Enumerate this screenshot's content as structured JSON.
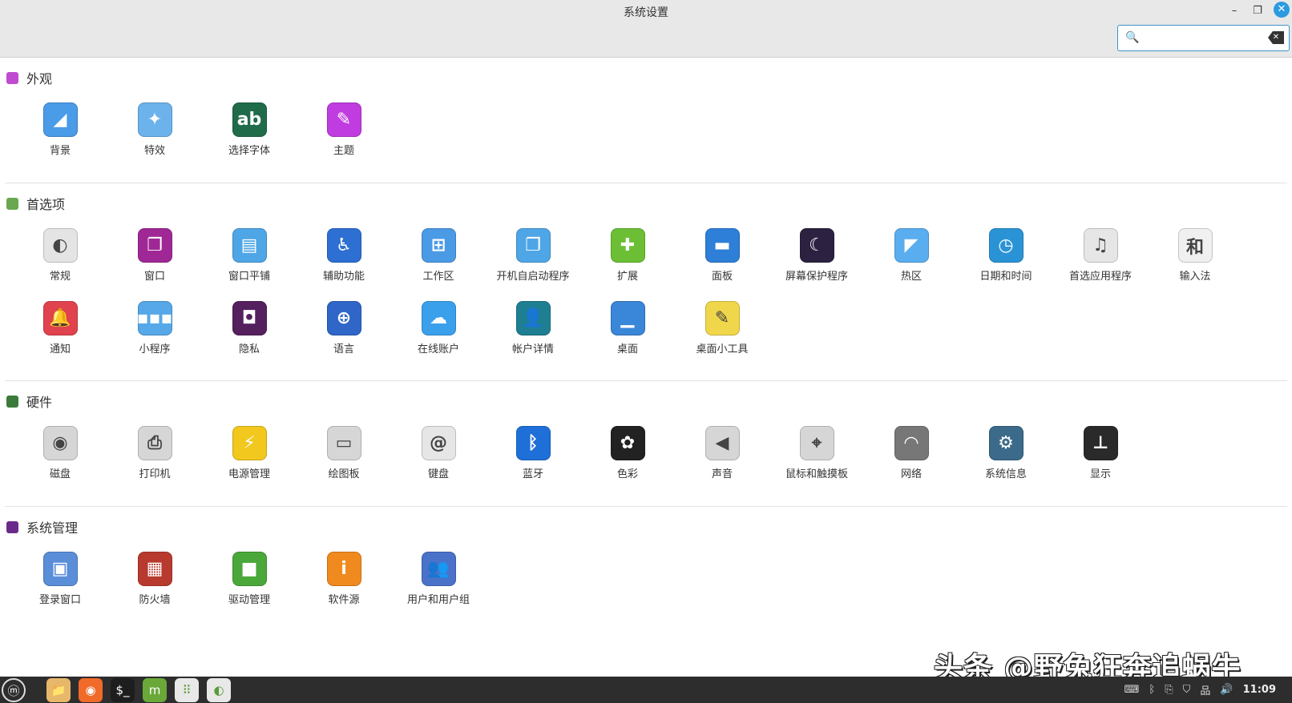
{
  "window": {
    "title": "系统设置",
    "minimize": "–",
    "maximize": "❐",
    "close": "✕"
  },
  "search": {
    "value": "",
    "placeholder": "",
    "icon": "search-icon",
    "clear_icon": "clear-icon"
  },
  "sections": [
    {
      "title": "外观",
      "color": "#c04bd0",
      "items": [
        {
          "label": "背景",
          "color": "#4a9be8",
          "glyph": "◢"
        },
        {
          "label": "特效",
          "color": "#6cb3ec",
          "glyph": "✦"
        },
        {
          "label": "选择字体",
          "color": "#1f6b4a",
          "glyph": "ab"
        },
        {
          "label": "主题",
          "color": "#c03ce0",
          "glyph": "✎"
        }
      ]
    },
    {
      "title": "首选项",
      "color": "#6aa84f",
      "items": [
        {
          "label": "常规",
          "color": "#e4e4e4",
          "glyph": "◐"
        },
        {
          "label": "窗口",
          "color": "#a02896",
          "glyph": "❐"
        },
        {
          "label": "窗口平铺",
          "color": "#4fa6e6",
          "glyph": "▤"
        },
        {
          "label": "辅助功能",
          "color": "#2d6fd2",
          "glyph": "♿"
        },
        {
          "label": "工作区",
          "color": "#4b9ae6",
          "glyph": "⊞"
        },
        {
          "label": "开机自启动程序",
          "color": "#4fa6e6",
          "glyph": "❐"
        },
        {
          "label": "扩展",
          "color": "#6cbf35",
          "glyph": "✚"
        },
        {
          "label": "面板",
          "color": "#2e7fd8",
          "glyph": "▬"
        },
        {
          "label": "屏幕保护程序",
          "color": "#2c2140",
          "glyph": "☾"
        },
        {
          "label": "热区",
          "color": "#5aaef0",
          "glyph": "◤"
        },
        {
          "label": "日期和时间",
          "color": "#2a93d6",
          "glyph": "◷"
        },
        {
          "label": "首选应用程序",
          "color": "#e6e6e6",
          "glyph": "♫"
        },
        {
          "label": "输入法",
          "color": "#f0f0f0",
          "glyph": "和"
        },
        {
          "label": "通知",
          "color": "#e0424e",
          "glyph": "🔔"
        },
        {
          "label": "小程序",
          "color": "#56a8e8",
          "glyph": "▪▪▪"
        },
        {
          "label": "隐私",
          "color": "#55205e",
          "glyph": "◘"
        },
        {
          "label": "语言",
          "color": "#2f66c8",
          "glyph": "⊕"
        },
        {
          "label": "在线账户",
          "color": "#3aa0ec",
          "glyph": "☁"
        },
        {
          "label": "帐户详情",
          "color": "#1e7f92",
          "glyph": "👤"
        },
        {
          "label": "桌面",
          "color": "#3a86d8",
          "glyph": "▁"
        },
        {
          "label": "桌面小工具",
          "color": "#f0d64a",
          "glyph": "✎"
        }
      ]
    },
    {
      "title": "硬件",
      "color": "#3c7a3c",
      "items": [
        {
          "label": "磁盘",
          "color": "#d6d6d6",
          "glyph": "◉"
        },
        {
          "label": "打印机",
          "color": "#d6d6d6",
          "glyph": "⎙"
        },
        {
          "label": "电源管理",
          "color": "#f2c81e",
          "glyph": "⚡"
        },
        {
          "label": "绘图板",
          "color": "#d6d6d6",
          "glyph": "▭"
        },
        {
          "label": "键盘",
          "color": "#e6e6e6",
          "glyph": "@"
        },
        {
          "label": "蓝牙",
          "color": "#1f6fd8",
          "glyph": "ᛒ"
        },
        {
          "label": "色彩",
          "color": "#222222",
          "glyph": "✿"
        },
        {
          "label": "声音",
          "color": "#d6d6d6",
          "glyph": "◀"
        },
        {
          "label": "鼠标和触摸板",
          "color": "#d6d6d6",
          "glyph": "⌖"
        },
        {
          "label": "网络",
          "color": "#777777",
          "glyph": "◠"
        },
        {
          "label": "系统信息",
          "color": "#3c6a8a",
          "glyph": "⚙"
        },
        {
          "label": "显示",
          "color": "#2a2a2a",
          "glyph": "⊥"
        }
      ]
    },
    {
      "title": "系统管理",
      "color": "#6a2c8a",
      "items": [
        {
          "label": "登录窗口",
          "color": "#5a8ed8",
          "glyph": "▣"
        },
        {
          "label": "防火墙",
          "color": "#b83a2e",
          "glyph": "▦"
        },
        {
          "label": "驱动管理",
          "color": "#4aa83a",
          "glyph": "■"
        },
        {
          "label": "软件源",
          "color": "#f08a1e",
          "glyph": "i"
        },
        {
          "label": "用户和用户组",
          "color": "#4a72c8",
          "glyph": "👥"
        }
      ]
    }
  ],
  "taskbar": {
    "apps": [
      {
        "name": "menu",
        "glyph": "ⓜ",
        "color": "#2d2d2d"
      },
      {
        "name": "files",
        "glyph": "📁",
        "color": "#e8b86a"
      },
      {
        "name": "firefox",
        "glyph": "◉",
        "color": "#f06a2a"
      },
      {
        "name": "terminal",
        "glyph": "$_",
        "color": "#1e1e1e"
      },
      {
        "name": "mintinstall",
        "glyph": "m",
        "color": "#6aa83a"
      },
      {
        "name": "apps",
        "glyph": "⠿",
        "color": "#e8e8e8"
      },
      {
        "name": "settings",
        "glyph": "◐",
        "color": "#e8e8e8"
      }
    ],
    "tray": [
      "⌨",
      "ᛒ",
      "⎘",
      "⛉",
      "品",
      "🔊"
    ],
    "clock": "11:09"
  },
  "watermark": "头条 @野兔狂奔追蜗牛"
}
